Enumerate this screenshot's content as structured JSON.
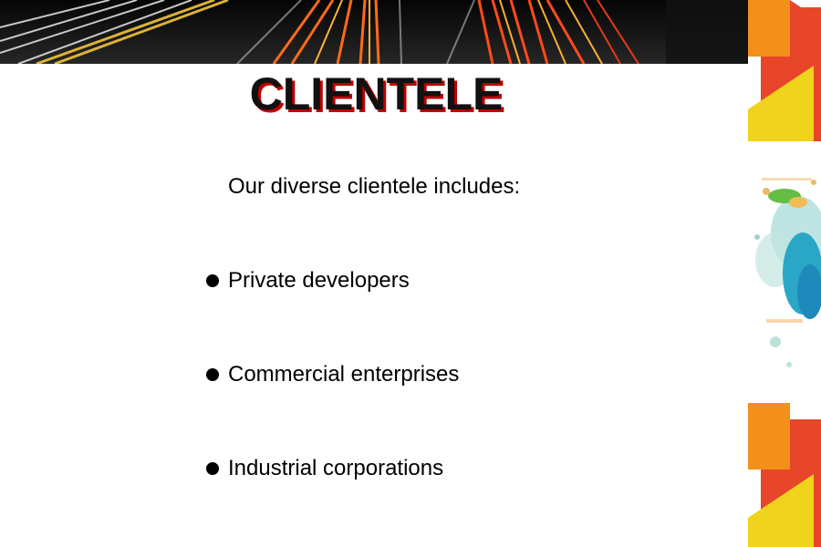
{
  "slide": {
    "title": "CLIENTELE",
    "intro": "Our diverse clientele includes:",
    "bullets": [
      "Private developers",
      "Commercial enterprises",
      "Industrial corporations"
    ]
  },
  "icons": {
    "header_image": "night-highway-light-trails",
    "side_graphic": "paint-splash-world-map",
    "shapes": "orange-red-yellow-blocks"
  },
  "colors": {
    "title_shadow": "#c00000",
    "orange": "#f39019",
    "red": "#e8462a",
    "yellow": "#f0d31c",
    "teal": "#1fa3c4"
  }
}
